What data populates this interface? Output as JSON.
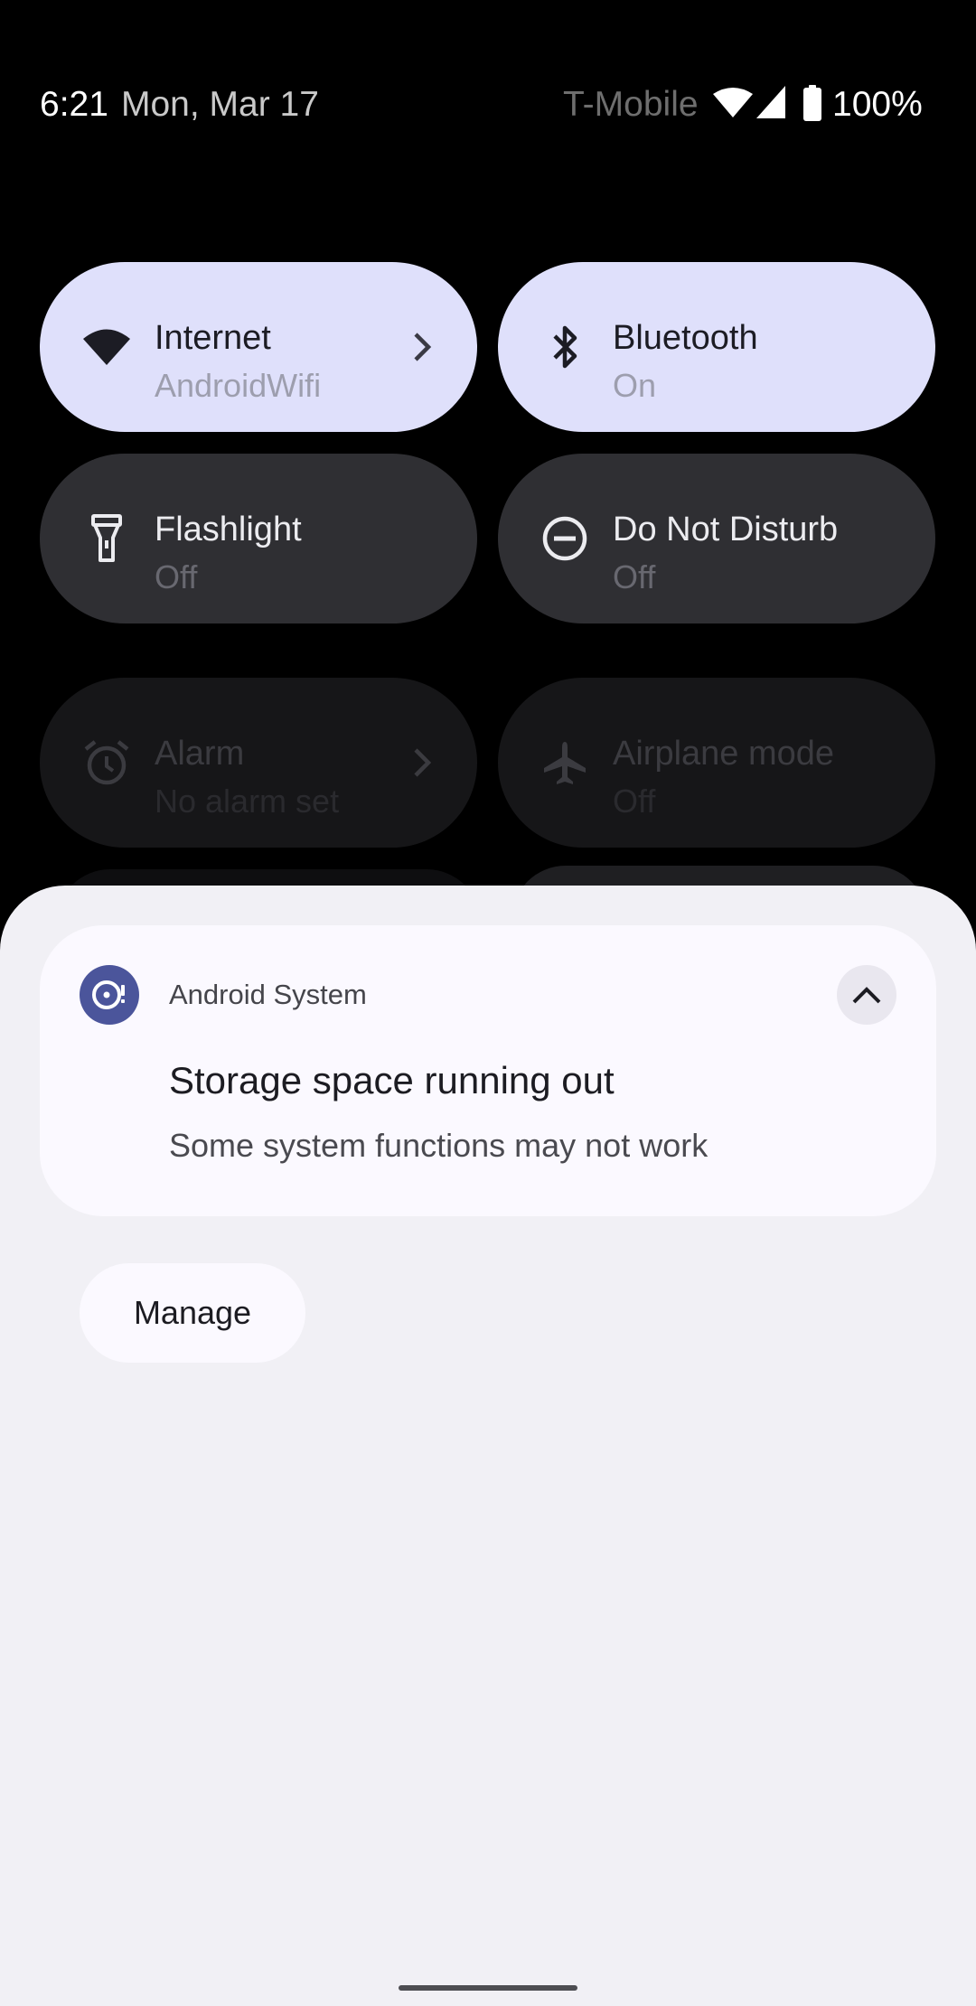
{
  "status_bar": {
    "time": "6:21",
    "date": "Mon, Mar 17",
    "carrier": "T-Mobile",
    "battery": "100%"
  },
  "quick_settings": {
    "tiles": [
      {
        "label": "Internet",
        "subtitle": "AndroidWifi",
        "state": "on",
        "icon": "wifi-icon",
        "has_chevron": true
      },
      {
        "label": "Bluetooth",
        "subtitle": "On",
        "state": "on",
        "icon": "bluetooth-icon",
        "has_chevron": false
      },
      {
        "label": "Flashlight",
        "subtitle": "Off",
        "state": "off",
        "icon": "flashlight-icon",
        "has_chevron": false
      },
      {
        "label": "Do Not Disturb",
        "subtitle": "Off",
        "state": "off",
        "icon": "do-not-disturb-icon",
        "has_chevron": false
      },
      {
        "label": "Alarm",
        "subtitle": "No alarm set",
        "state": "off",
        "icon": "alarm-icon",
        "has_chevron": true
      },
      {
        "label": "Airplane mode",
        "subtitle": "Off",
        "state": "off",
        "icon": "airplane-icon",
        "has_chevron": false
      }
    ]
  },
  "notification": {
    "app_name": "Android System",
    "app_icon": "storage-alert-icon",
    "title": "Storage space running out",
    "body": "Some system functions may not work",
    "expanded": true
  },
  "actions": {
    "manage_label": "Manage"
  },
  "colors": {
    "tile_on": "#dfe0fb",
    "tile_off": "#2f2f33",
    "shade_background": "#f1f0f5",
    "app_icon_accent": "#4b559b"
  }
}
